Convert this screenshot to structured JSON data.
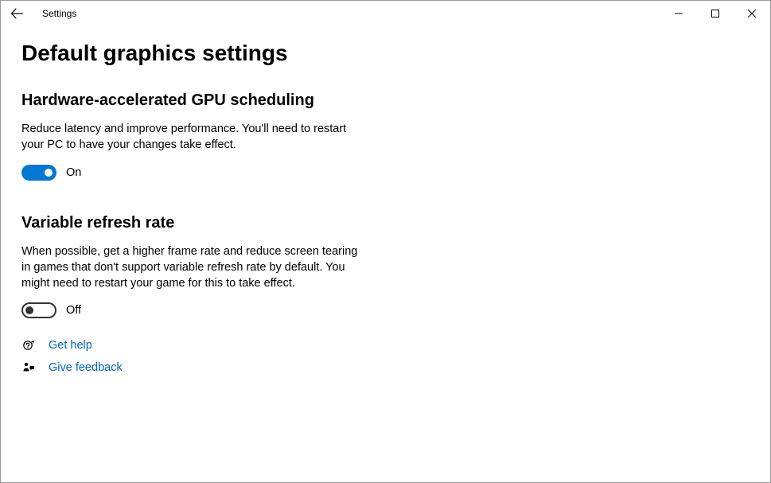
{
  "titlebar": {
    "title": "Settings"
  },
  "page": {
    "title": "Default graphics settings"
  },
  "sections": {
    "gpu": {
      "title": "Hardware-accelerated GPU scheduling",
      "desc": "Reduce latency and improve performance. You'll need to restart your PC to have your changes take effect.",
      "state_label": "On",
      "state": "on"
    },
    "vrr": {
      "title": "Variable refresh rate",
      "desc": "When possible, get a higher frame rate and reduce screen tearing in games that don't support variable refresh rate by default. You might need to restart your game for this to take effect.",
      "state_label": "Off",
      "state": "off"
    }
  },
  "links": {
    "help": "Get help",
    "feedback": "Give feedback"
  }
}
